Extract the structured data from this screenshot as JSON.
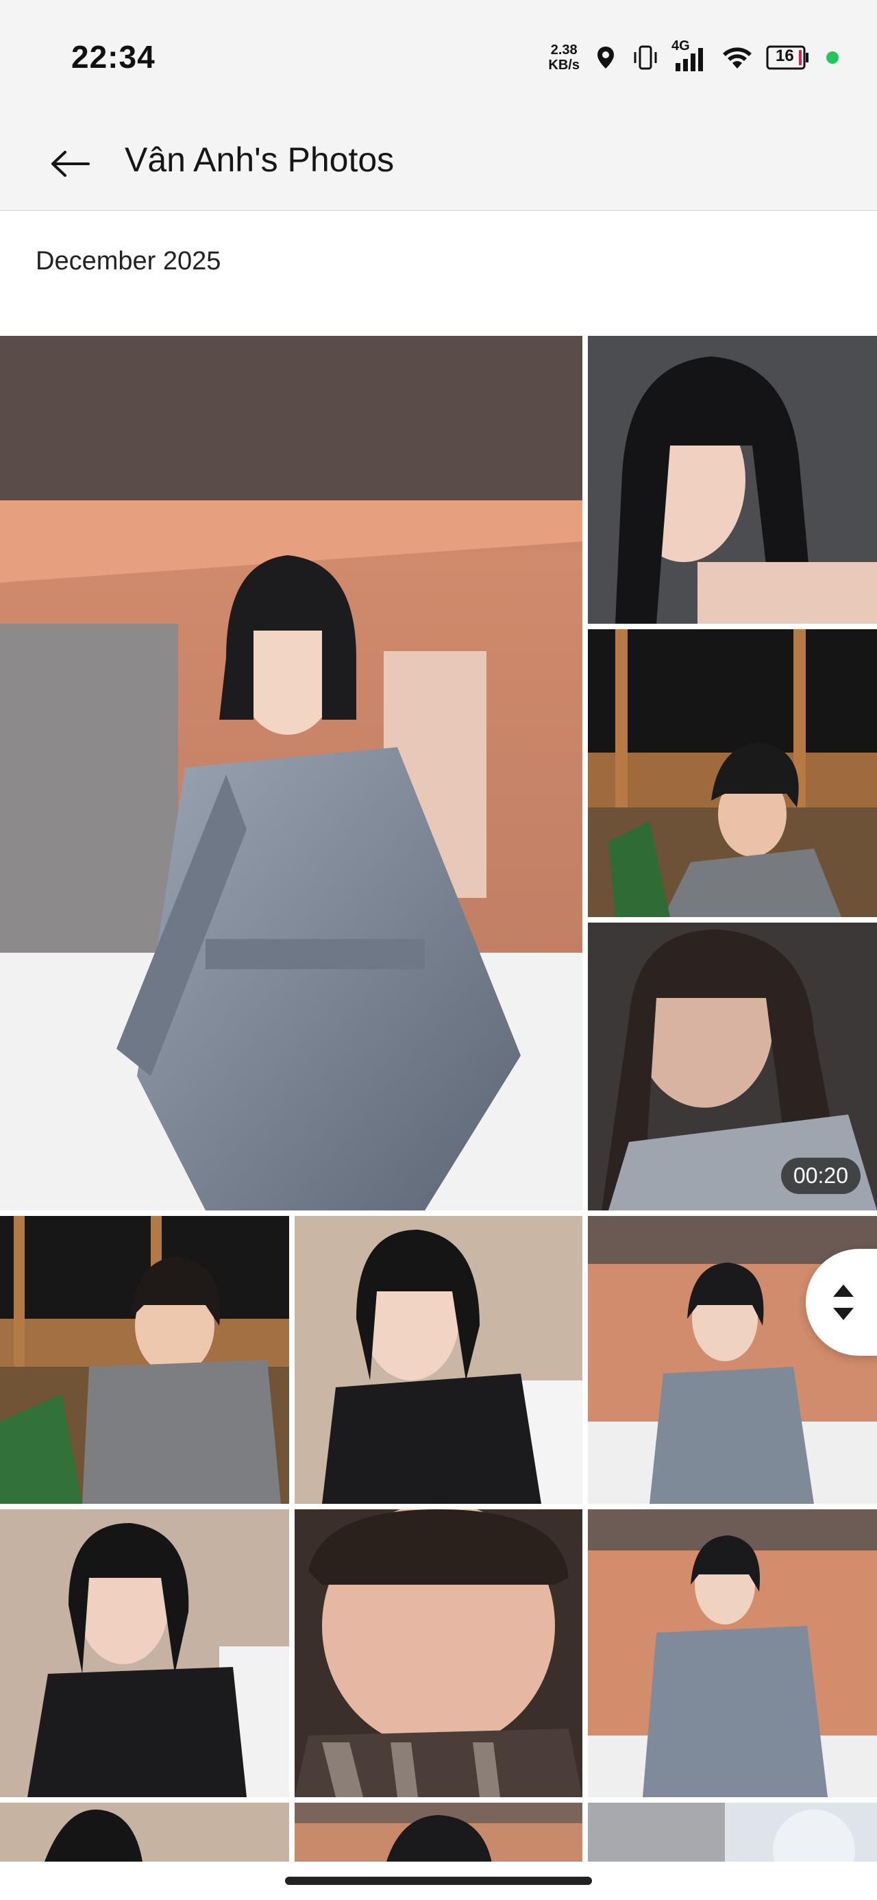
{
  "status_bar": {
    "time": "22:34",
    "net_speed_value": "2.38",
    "net_speed_unit": "KB/s",
    "network_type": "4G",
    "battery_level": "16",
    "icons": [
      "location-icon",
      "vibrate-icon",
      "signal-icon",
      "wifi-icon",
      "battery-icon",
      "privacy-dot"
    ]
  },
  "app_bar": {
    "back_icon": "arrow-left-icon",
    "title": "Vân Anh's Photos"
  },
  "section": {
    "date": "December 2025"
  },
  "photos": [
    {
      "id": "p1",
      "kind": "photo"
    },
    {
      "id": "p2",
      "kind": "photo"
    },
    {
      "id": "p3",
      "kind": "photo"
    },
    {
      "id": "p4",
      "kind": "video",
      "duration": "00:20"
    },
    {
      "id": "p5",
      "kind": "photo"
    },
    {
      "id": "p6",
      "kind": "photo"
    },
    {
      "id": "p7",
      "kind": "photo"
    },
    {
      "id": "p8",
      "kind": "photo"
    },
    {
      "id": "p9",
      "kind": "photo"
    },
    {
      "id": "p10",
      "kind": "photo"
    },
    {
      "id": "p11",
      "kind": "photo"
    },
    {
      "id": "p12",
      "kind": "photo"
    },
    {
      "id": "p13",
      "kind": "photo"
    }
  ],
  "fast_scroll": {
    "icon": "up-down-arrows-icon"
  },
  "colors": {
    "bar_bg": "#f4f4f4",
    "accent_dot": "#22c55e"
  }
}
